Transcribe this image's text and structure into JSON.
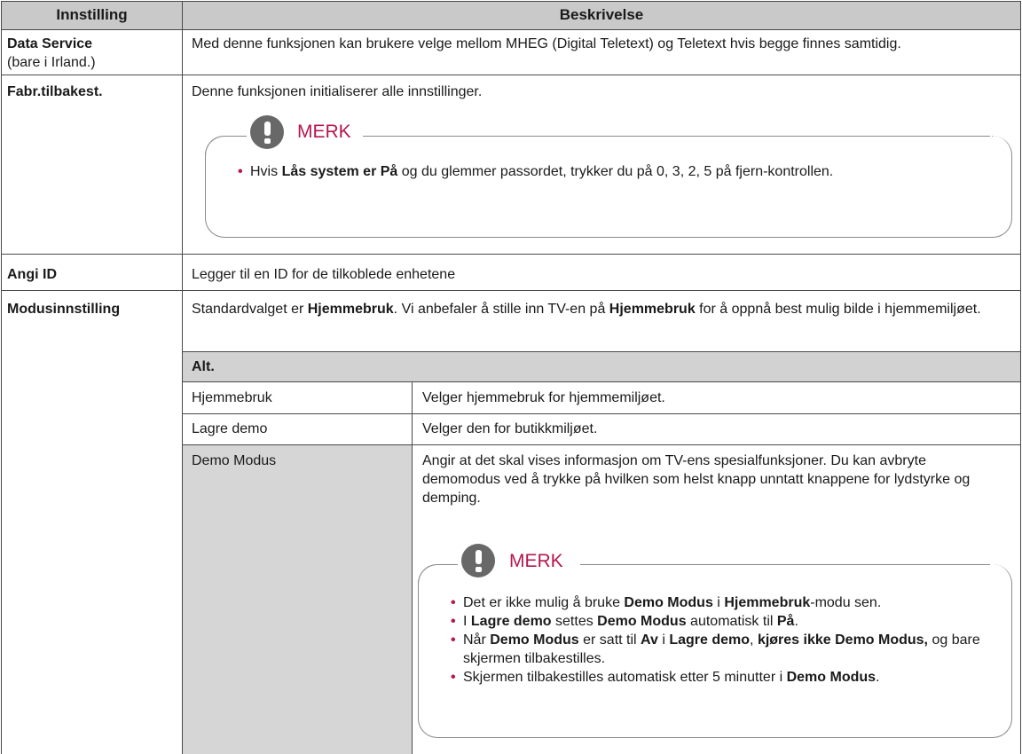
{
  "table": {
    "headers": {
      "setting": "Innstilling",
      "description": "Beskrivelse"
    },
    "rows": {
      "data_service": {
        "name": "Data Service",
        "sub": "(bare i Irland.)",
        "desc": "Med denne funksjonen kan brukere velge mellom MHEG (Digital Teletext) og Teletext hvis begge finnes samtidig."
      },
      "factory_reset": {
        "name": "Fabr.tilbakest.",
        "desc": "Denne funksjonen initialiserer alle innstillinger.",
        "note": {
          "title": "MERK",
          "bullet1": {
            "t1": "Hvis ",
            "b1": "Lås system er På",
            "t2": " og du glemmer passordet, trykker du på 0, 3, 2, 5 på fjern-kontrollen."
          }
        }
      },
      "set_id": {
        "name": "Angi ID",
        "desc": "Legger til en ID for de tilkoblede enhetene"
      },
      "mode_setting": {
        "name": "Modusinnstilling",
        "desc": {
          "t1": "Standardvalget er ",
          "b1": "Hjemmebruk",
          "t2": ". Vi anbefaler å stille inn TV-en på ",
          "b2": "Hjemmebruk",
          "t3": " for å oppnå best mulig bilde i hjemmemiljøet."
        },
        "options_header": "Alt.",
        "options": {
          "home": {
            "name": "Hjemmebruk",
            "desc": "Velger hjemmebruk for hjemmemiljøet."
          },
          "store": {
            "name": "Lagre demo",
            "desc": "Velger den for butikkmiljøet."
          },
          "demo": {
            "name": "Demo Modus",
            "desc": "Angir at det skal vises informasjon om TV-ens spesialfunksjoner. Du kan avbryte demomodus ved å trykke på hvilken som helst knapp unntatt knappene for lydstyrke og demping."
          }
        },
        "note": {
          "title": "MERK",
          "bullet1": {
            "t1": "Det er ikke mulig å bruke ",
            "b1": "Demo Modus",
            "t2": " i ",
            "b2": "Hjemmebruk",
            "t3": "-modu sen."
          },
          "bullet2": {
            "t1": "I ",
            "b1": "Lagre demo",
            "t2": " settes ",
            "b2": "Demo Modus",
            "t3": " automatisk til ",
            "b3": "På",
            "t4": "."
          },
          "bullet3": {
            "t1": "Når ",
            "b1": "Demo Modus",
            "t2": " er satt til ",
            "b2": "Av",
            "t3": " i ",
            "b3": "Lagre demo",
            "t4": ", ",
            "b4": "kjøres ikke Demo Modus,",
            "t5": " og bare skjermen tilbakestilles."
          },
          "bullet4": {
            "t1": "Skjermen tilbakestilles automatisk etter 5 minutter i ",
            "b1": "Demo Modus",
            "t2": "."
          }
        }
      }
    }
  }
}
